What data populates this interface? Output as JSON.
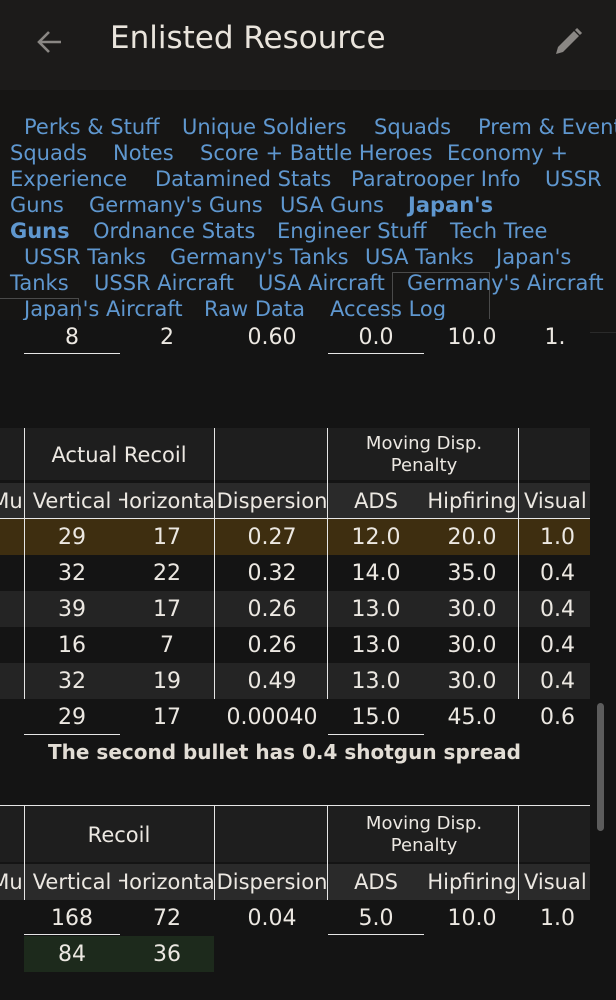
{
  "app_bar": {
    "title": "Enlisted Resource"
  },
  "nav": {
    "links": [
      "Perks & Stuff",
      "Unique Soldiers",
      "Squads",
      "Prem & Event",
      "Squads",
      "Notes",
      "Score + Battle Heroes",
      "Economy +",
      "Experience",
      "Datamined Stats",
      "Paratrooper Info",
      "USSR",
      "Guns",
      "Germany's Guns",
      "USA Guns",
      "Japan's",
      "Guns",
      "Ordnance Stats",
      "Engineer Stuff",
      "Tech Tree",
      "USSR Tanks",
      "Germany's Tanks",
      "USA Tanks",
      "Japan's",
      "Tanks",
      "USSR Aircraft",
      "USA Aircraft",
      "Germany's Aircraft",
      "Japan's Aircraft",
      "Raw Data",
      "Access Log"
    ]
  },
  "table1": {
    "top_row": [
      "8",
      "2",
      "0.60",
      "0.0",
      "10.0",
      "1."
    ],
    "group_headers": {
      "recoil": "Actual Recoil",
      "moving": "Moving Disp. Penalty"
    },
    "columns": [
      "Mu",
      "Vertical",
      "Horizontal",
      "Dispersion",
      "ADS",
      "Hipfiring",
      "Visual"
    ],
    "rows": [
      [
        "29",
        "17",
        "0.27",
        "12.0",
        "20.0",
        "1.0"
      ],
      [
        "32",
        "22",
        "0.32",
        "14.0",
        "35.0",
        "0.4"
      ],
      [
        "39",
        "17",
        "0.26",
        "13.0",
        "30.0",
        "0.4"
      ],
      [
        "16",
        "7",
        "0.26",
        "13.0",
        "30.0",
        "0.4"
      ],
      [
        "32",
        "19",
        "0.49",
        "13.0",
        "30.0",
        "0.4"
      ],
      [
        "29",
        "17",
        "0.00040",
        "15.0",
        "45.0",
        "0.6"
      ]
    ]
  },
  "note": "The second bullet has 0.4 shotgun spread",
  "table2": {
    "group_headers": {
      "recoil": "Recoil",
      "moving": "Moving Disp. Penalty"
    },
    "columns": [
      "Mu",
      "Vertical",
      "Horizontal",
      "Dispersion",
      "ADS",
      "Hipfiring",
      "Visual"
    ],
    "rows": [
      [
        "168",
        "72",
        "0.04",
        "5.0",
        "10.0",
        "1.0"
      ],
      [
        "84",
        "36",
        "",
        "",
        "",
        ""
      ]
    ]
  },
  "colors": {
    "accent_row": "#3e2e10",
    "link": "#5f97cf",
    "green_cell": "#1d2a1c"
  }
}
